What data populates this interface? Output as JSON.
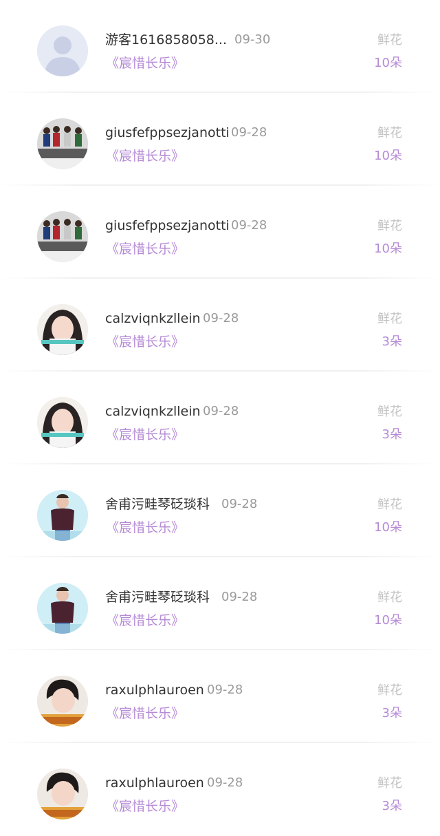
{
  "rows": [
    {
      "name": "游客1616858058...",
      "date": "09-30",
      "book": "《宸惜长乐》",
      "gift_type": "鲜花",
      "gift_count": "10朵",
      "avatar": "default-avatar"
    },
    {
      "name": "giusfefppsezjanotti",
      "date": "09-28",
      "book": "《宸惜长乐》",
      "gift_type": "鲜花",
      "gift_count": "10朵",
      "avatar": "group-photo-avatar"
    },
    {
      "name": "giusfefppsezjanotti",
      "date": "09-28",
      "book": "《宸惜长乐》",
      "gift_type": "鲜花",
      "gift_count": "10朵",
      "avatar": "group-photo-avatar"
    },
    {
      "name": "calzviqnkzllein",
      "date": "09-28",
      "book": "《宸惜长乐》",
      "gift_type": "鲜花",
      "gift_count": "3朵",
      "avatar": "girl-portrait-avatar"
    },
    {
      "name": "calzviqnkzllein",
      "date": "09-28",
      "book": "《宸惜长乐》",
      "gift_type": "鲜花",
      "gift_count": "3朵",
      "avatar": "girl-portrait-avatar"
    },
    {
      "name": "舍甫污畦琴砭琰科",
      "date": "09-28",
      "book": "《宸惜长乐》",
      "gift_type": "鲜花",
      "gift_count": "10朵",
      "avatar": "boy-sweater-avatar"
    },
    {
      "name": "舍甫污畦琴砭琰科",
      "date": "09-28",
      "book": "《宸惜长乐》",
      "gift_type": "鲜花",
      "gift_count": "10朵",
      "avatar": "boy-sweater-avatar"
    },
    {
      "name": "raxulphlauroen",
      "date": "09-28",
      "book": "《宸惜长乐》",
      "gift_type": "鲜花",
      "gift_count": "3朵",
      "avatar": "boy-portrait-avatar"
    },
    {
      "name": "raxulphlauroen",
      "date": "09-28",
      "book": "《宸惜长乐》",
      "gift_type": "鲜花",
      "gift_count": "3朵",
      "avatar": "boy-portrait-avatar"
    }
  ],
  "colors": {
    "name": "#333333",
    "date": "#9a9a9a",
    "book": "#b58ad6",
    "gift_type": "#c2c2c2",
    "gift_count": "#b58ad6",
    "divider": "#f0f0f0"
  }
}
